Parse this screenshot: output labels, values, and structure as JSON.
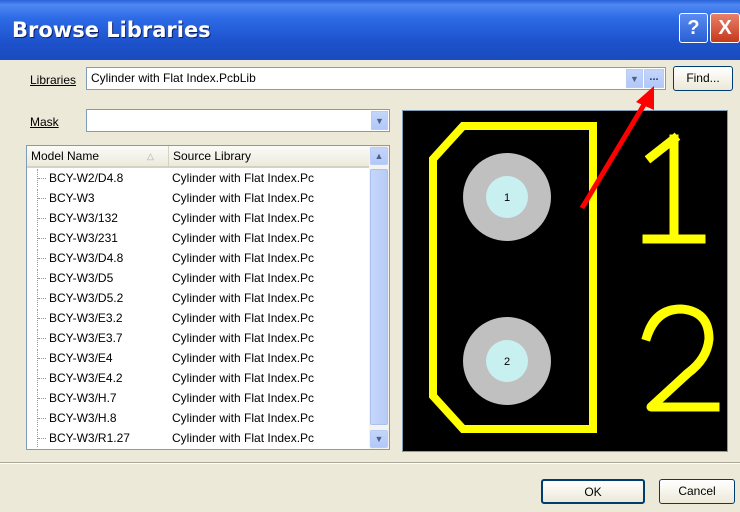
{
  "window": {
    "title": "Browse Libraries"
  },
  "titlebar": {
    "help_label": "?",
    "close_label": "X"
  },
  "libraries": {
    "label": "Libraries",
    "value": "Cylinder with Flat Index.PcbLib",
    "browse_label": "...",
    "find_label": "Find..."
  },
  "mask": {
    "label": "Mask",
    "value": ""
  },
  "table": {
    "columns": [
      "Model Name",
      "Source Library"
    ],
    "rows": [
      {
        "name": "BCY-W2/D4.8",
        "source": "Cylinder with Flat Index.Pc"
      },
      {
        "name": "BCY-W3",
        "source": "Cylinder with Flat Index.Pc"
      },
      {
        "name": "BCY-W3/132",
        "source": "Cylinder with Flat Index.Pc"
      },
      {
        "name": "BCY-W3/231",
        "source": "Cylinder with Flat Index.Pc"
      },
      {
        "name": "BCY-W3/D4.8",
        "source": "Cylinder with Flat Index.Pc"
      },
      {
        "name": "BCY-W3/D5",
        "source": "Cylinder with Flat Index.Pc"
      },
      {
        "name": "BCY-W3/D5.2",
        "source": "Cylinder with Flat Index.Pc"
      },
      {
        "name": "BCY-W3/E3.2",
        "source": "Cylinder with Flat Index.Pc"
      },
      {
        "name": "BCY-W3/E3.7",
        "source": "Cylinder with Flat Index.Pc"
      },
      {
        "name": "BCY-W3/E4",
        "source": "Cylinder with Flat Index.Pc"
      },
      {
        "name": "BCY-W3/E4.2",
        "source": "Cylinder with Flat Index.Pc"
      },
      {
        "name": "BCY-W3/H.7",
        "source": "Cylinder with Flat Index.Pc"
      },
      {
        "name": "BCY-W3/H.8",
        "source": "Cylinder with Flat Index.Pc"
      },
      {
        "name": "BCY-W3/R1.27",
        "source": "Cylinder with Flat Index.Pc"
      }
    ]
  },
  "preview": {
    "pad1_label": "1",
    "pad2_label": "2",
    "silk1_label": "1",
    "silk2_label": "2",
    "colors": {
      "background": "#000000",
      "silkscreen": "#ffff00",
      "pad": "#c0c0c0",
      "hole": "#c8f0f0"
    }
  },
  "footer": {
    "ok_label": "OK",
    "cancel_label": "Cancel"
  }
}
